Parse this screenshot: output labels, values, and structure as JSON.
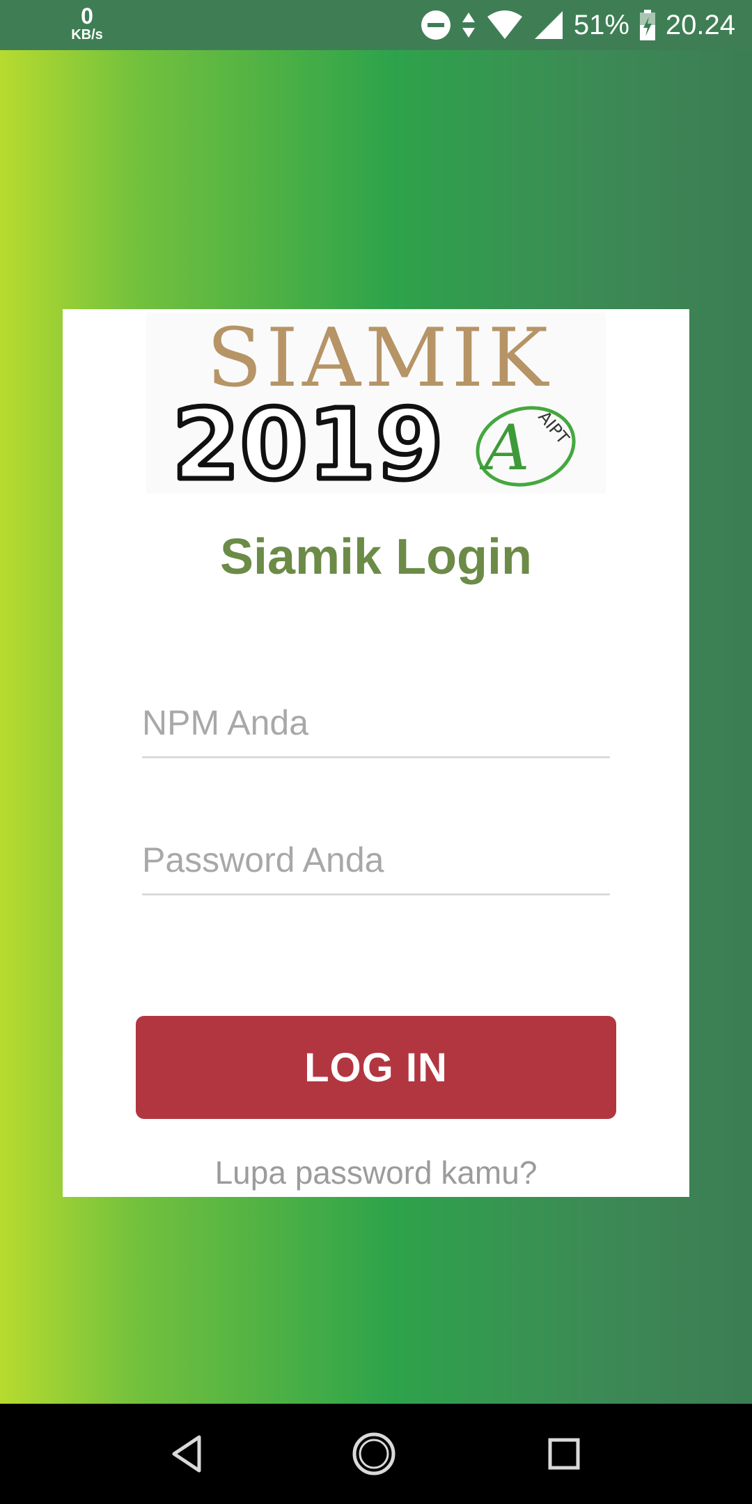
{
  "status_bar": {
    "net_speed": "0",
    "net_unit": "KB/s",
    "battery": "51%",
    "time": "20.24",
    "icons": [
      "dnd-icon",
      "data-arrows-icon",
      "wifi-icon",
      "signal-icon",
      "battery-icon"
    ]
  },
  "logo": {
    "line1": "SIAMIK",
    "line2": "2019",
    "badge_letter": "A",
    "badge_text": "AIPT"
  },
  "login": {
    "title": "Siamik Login",
    "npm_placeholder": "NPM Anda",
    "password_placeholder": "Password Anda",
    "button_label": "LOG IN",
    "forgot_link": "Lupa password kamu?"
  },
  "nav_bar": {
    "icons": [
      "back-icon",
      "home-icon",
      "recents-icon"
    ]
  },
  "colors": {
    "status_bar": "#3f7e55",
    "title": "#6b8b47",
    "button": "#b23640",
    "card": "#ffffff"
  }
}
